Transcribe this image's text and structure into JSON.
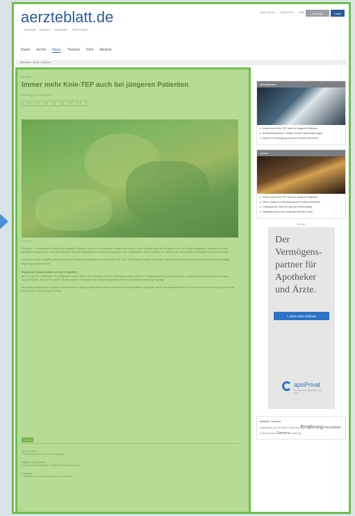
{
  "site": {
    "logo": "aerzteblatt.de",
    "logo_sub": [
      "Ärzteblatt",
      "Dossiers",
      "Newsletter",
      "Stellenmarkt"
    ],
    "top_links": [
      "Mein Archiv",
      "Mein Profil",
      "Hilfe",
      "Kontakt"
    ],
    "abo_button": "Jetzt Abo",
    "login_button": "Login",
    "nav": [
      "Home",
      "Archiv",
      "News",
      "Themen",
      "Print",
      "Medizin"
    ],
    "nav_active": "News",
    "breadcrumb": "Startseite > News > Medizin"
  },
  "article": {
    "kicker": "Medizin",
    "title": "Immer mehr Knie-TEP auch bei jüngeren Patienten",
    "meta": "Dienstag, 17. April 2018",
    "tool_count": 8,
    "caption": "Foto: dpa",
    "paragraphs": [
      "Gütersloh – Orthopädische Eingriffe an jüngeren Patienten nehmen zu. Künstliche Kniegelenke werden immer häufiger auch bei Menschen unter 60 Jahren eingesetzt. Das geht aus einer aktuellen Analyse hervor. Demnach stieg die Zahl der Operationen in dieser Altersgruppe in den vergangenen Jahren deutlich an, während die Gesamtzahl der Eingriffe nur moderat wuchs.",
      "Die Daten zu den Eingriffen stammen aus den Krankenhausstatistiken der Jahre 2013 bis 2016. Die Experten weisen darauf hin, dass die Entscheidung für ein künstliches Gelenk sorgfältig abgewogen werden sollte.",
      "Wer vor dem 60. Lebensjahr ein künstliches Gelenk erhält, muss häufiger mit einer Wechseloperation rechnen. Fachgesellschaften empfehlen daher, zunächst alle konservativen Therapien auszuschöpfen. Auch die Deutsche Gesellschaft für Orthopädie und Unfallchirurgie hat Leitlinien zur Indikationsstellung vorgelegt.",
      "Die Analyse zeigt zudem regionale Unterschiede. In einigen Landkreisen werden deutlich mehr Knieprothesen implantiert als im Bundesdurchschnitt. Die Autoren fordern mehr Transparenz und eine bessere Versorgungsforschung."
    ],
    "subheading": "Regionale Unterschiede bei den Eingriffen",
    "tag": "Mehr",
    "related": [
      {
        "head": "Alle Themen",
        "item": "» Knieendoprothetik in der Versorgung"
      },
      {
        "head": "Weitere Nachrichten",
        "item": "» Endoprothesenregister veröffentlicht Jahresbericht"
      },
      {
        "head": "Dossiers",
        "item": "» Orthopädie und Unfallchirurgie im Überblick"
      }
    ]
  },
  "sidebar": {
    "box1_head": "Meistgelesen",
    "box1_items": [
      "Immer mehr Knie-TEP auch bei jüngeren Patienten",
      "Krankenhausreform: Kliniken fordern Nachbesserungen",
      "Studie zur Versorgung chronisch kranker Menschen"
    ],
    "box2_head": "Videos",
    "box2_items": [
      "Immer mehr Knie-TEP auch bei jüngeren Patienten",
      "Neue Leitlinie zur Behandlung von Rückenschmerzen",
      "Organspende: Zahl der Spender bleibt niedrig",
      "Digitalisierung in der Arztpraxis schreitet voran"
    ],
    "ad_label": "Anzeige",
    "ad_text": "Der Vermögens-partner für Apotheker und Ärzte.",
    "ad_button": "» Jetzt mehr erfahren",
    "ad_logo_name": "apoPrivat",
    "ad_logo_small": "Privatbank der Apotheker und Ärzte",
    "tags_title": "Aktuelle Themen",
    "tags": [
      {
        "text": "Antibiotika",
        "size": "small"
      },
      {
        "text": "Arzneimittel",
        "size": "small"
      },
      {
        "text": "Diabetes",
        "size": "small"
      },
      {
        "text": "Ernährung",
        "size": "big"
      },
      {
        "text": "Herzinfarkt",
        "size": "mid"
      },
      {
        "text": "Krankenhaus",
        "size": "small"
      },
      {
        "text": "Demenz",
        "size": "mid"
      },
      {
        "text": "Impfung",
        "size": "small"
      }
    ]
  }
}
